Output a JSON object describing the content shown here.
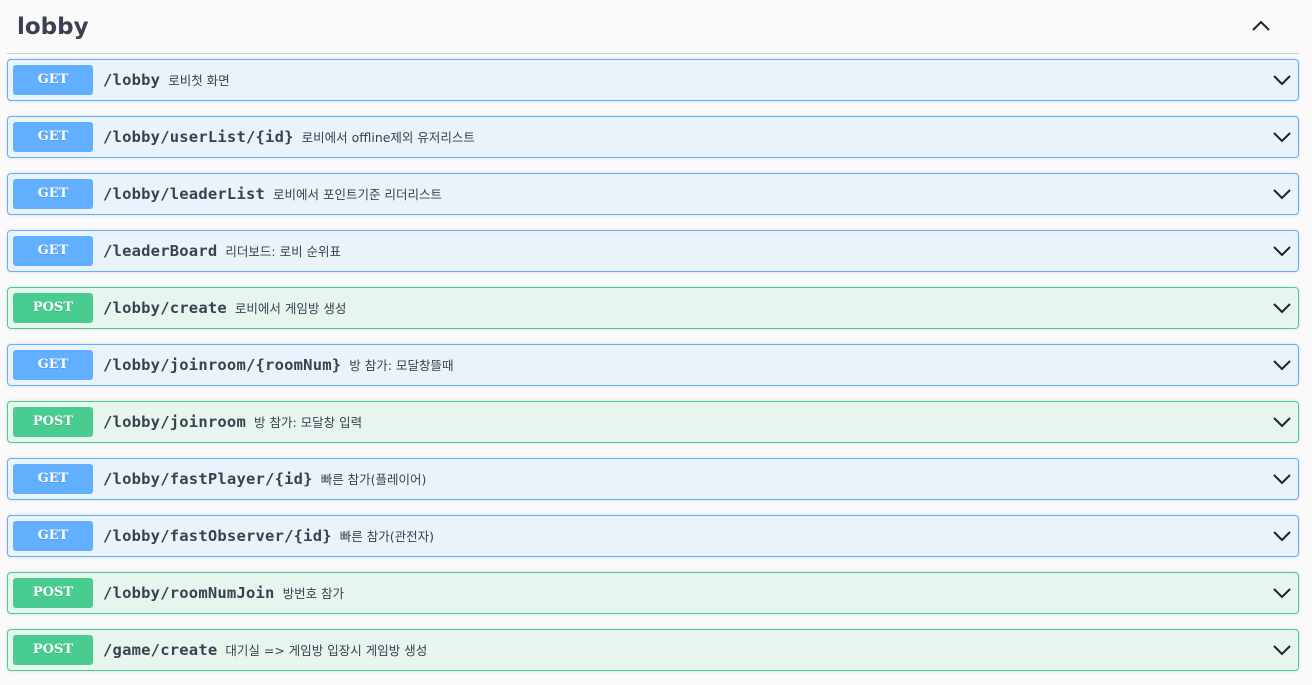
{
  "section": {
    "title": "lobby"
  },
  "colors": {
    "get": "#61affe",
    "post": "#49cc90"
  },
  "operations": [
    {
      "method": "GET",
      "path": "/lobby",
      "summary": "로비첫 화면"
    },
    {
      "method": "GET",
      "path": "/lobby/userList/{id}",
      "summary": "로비에서 offline제외 유저리스트"
    },
    {
      "method": "GET",
      "path": "/lobby/leaderList",
      "summary": "로비에서 포인트기준 리더리스트"
    },
    {
      "method": "GET",
      "path": "/leaderBoard",
      "summary": "리더보드: 로비 순위표"
    },
    {
      "method": "POST",
      "path": "/lobby/create",
      "summary": "로비에서 게임방 생성"
    },
    {
      "method": "GET",
      "path": "/lobby/joinroom/{roomNum}",
      "summary": "방 참가: 모달창뜰때"
    },
    {
      "method": "POST",
      "path": "/lobby/joinroom",
      "summary": "방 참가: 모달창 입력"
    },
    {
      "method": "GET",
      "path": "/lobby/fastPlayer/{id}",
      "summary": "빠른 참가(플레이어)"
    },
    {
      "method": "GET",
      "path": "/lobby/fastObserver/{id}",
      "summary": "빠른 참가(관전자)"
    },
    {
      "method": "POST",
      "path": "/lobby/roomNumJoin",
      "summary": "방번호 참가"
    },
    {
      "method": "POST",
      "path": "/game/create",
      "summary": "대기실 => 게임방 입장시 게임방 생성"
    }
  ]
}
